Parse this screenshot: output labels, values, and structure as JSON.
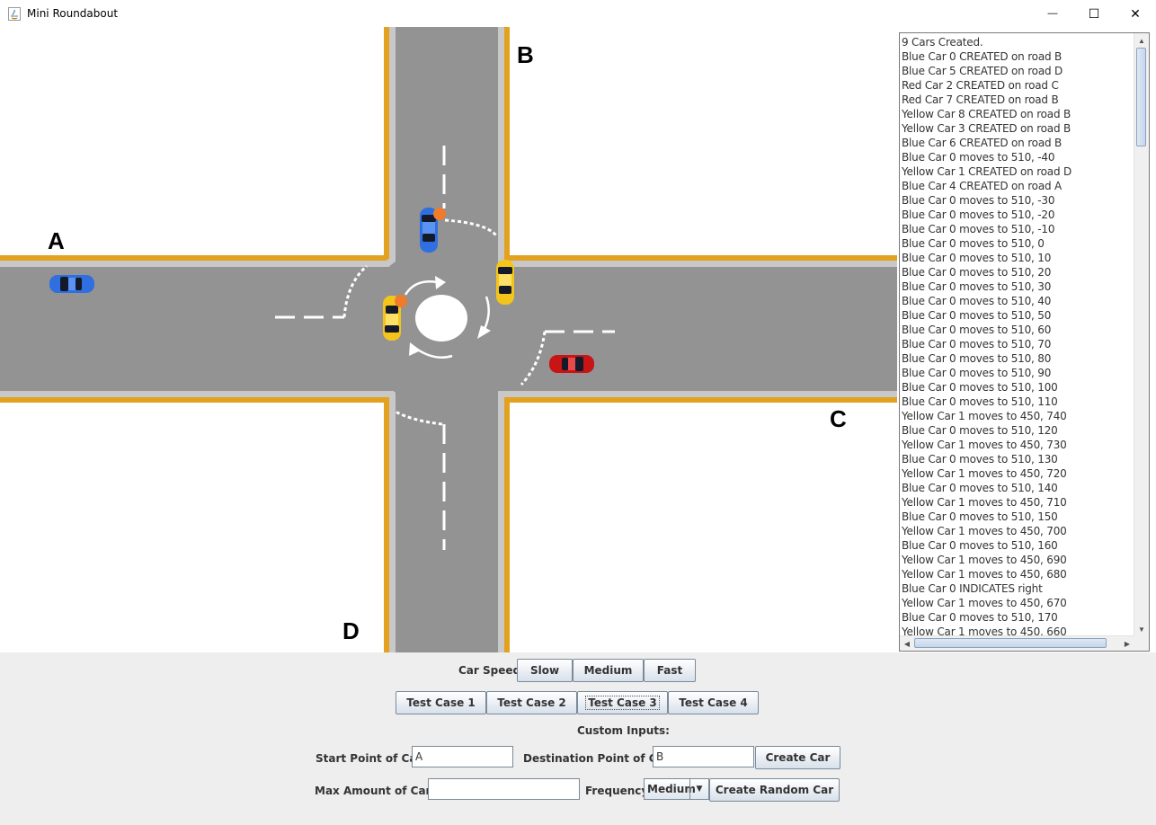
{
  "window": {
    "title": "Mini Roundabout",
    "minimize_glyph": "—",
    "maximize_glyph": "☐",
    "close_glyph": "✕"
  },
  "scene": {
    "road_labels": {
      "a": "A",
      "b": "B",
      "c": "C",
      "d": "D"
    },
    "colors": {
      "asphalt": "#939393",
      "curb": "#c8c8c8",
      "edge_line": "#e2a21f",
      "marking": "#ffffff",
      "car_blue": "#2f6fe0",
      "car_red": "#c81414",
      "car_yellow": "#f3c51b",
      "indicator": "#f07b2b"
    },
    "cars": [
      {
        "color": "blue",
        "heading": "east",
        "indicator": false
      },
      {
        "color": "blue",
        "heading": "south",
        "indicator": true
      },
      {
        "color": "yellow",
        "heading": "south",
        "indicator": false
      },
      {
        "color": "yellow",
        "heading": "north",
        "indicator": true
      },
      {
        "color": "red",
        "heading": "west",
        "indicator": false
      }
    ]
  },
  "log": {
    "lines": [
      "9 Cars Created.",
      "Blue Car 0 CREATED on road B",
      "Blue Car 5 CREATED on road D",
      "Red Car 2 CREATED on road C",
      "Red Car 7 CREATED on road B",
      "Yellow Car 8 CREATED on road B",
      "Yellow Car 3 CREATED on road B",
      "Blue Car 6 CREATED on road B",
      "Blue Car 0 moves to 510, -40",
      "Yellow Car 1 CREATED on road D",
      "Blue Car 4 CREATED on road A",
      "Blue Car 0 moves to 510, -30",
      "Blue Car 0 moves to 510, -20",
      "Blue Car 0 moves to 510, -10",
      "Blue Car 0 moves to 510, 0",
      "Blue Car 0 moves to 510, 10",
      "Blue Car 0 moves to 510, 20",
      "Blue Car 0 moves to 510, 30",
      "Blue Car 0 moves to 510, 40",
      "Blue Car 0 moves to 510, 50",
      "Blue Car 0 moves to 510, 60",
      "Blue Car 0 moves to 510, 70",
      "Blue Car 0 moves to 510, 80",
      "Blue Car 0 moves to 510, 90",
      "Blue Car 0 moves to 510, 100",
      "Blue Car 0 moves to 510, 110",
      "Yellow Car 1 moves to 450, 740",
      "Blue Car 0 moves to 510, 120",
      "Yellow Car 1 moves to 450, 730",
      "Blue Car 0 moves to 510, 130",
      "Yellow Car 1 moves to 450, 720",
      "Blue Car 0 moves to 510, 140",
      "Yellow Car 1 moves to 450, 710",
      "Blue Car 0 moves to 510, 150",
      "Yellow Car 1 moves to 450, 700",
      "Blue Car 0 moves to 510, 160",
      "Yellow Car 1 moves to 450, 690",
      "Yellow Car 1 moves to 450, 680",
      "Blue Car 0 INDICATES right",
      "Yellow Car 1 moves to 450, 670",
      "Blue Car 0 moves to 510, 170",
      "Yellow Car 1 moves to 450, 660"
    ]
  },
  "controls": {
    "car_speed_label": "Car Speed:",
    "speed_buttons": [
      "Slow",
      "Medium",
      "Fast"
    ],
    "test_cases": [
      "Test Case 1",
      "Test Case 2",
      "Test Case 3",
      "Test Case 4"
    ],
    "custom_inputs_label": "Custom Inputs:",
    "start_point_label": "Start Point of Car:",
    "start_point_value": "A",
    "destination_label": "Destination Point of Car:",
    "destination_value": "B",
    "create_car_label": "Create Car",
    "max_cars_label": "Max Amount of Cars:",
    "max_cars_value": "",
    "frequency_label": "Frequency:",
    "frequency_value": "Medium",
    "create_random_label": "Create Random Car"
  }
}
